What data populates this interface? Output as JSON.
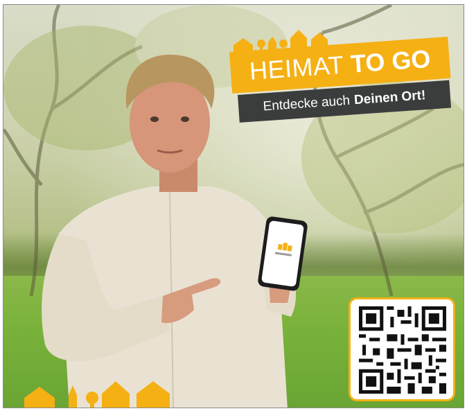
{
  "brand": {
    "title_regular": "HEIMAT",
    "title_bold": "TO GO",
    "subtitle_regular": "Entdecke auch",
    "subtitle_bold": "Deinen Ort!"
  },
  "colors": {
    "accent": "#f5b014",
    "subtitle_bg": "#3b3d3d",
    "text": "#ffffff"
  },
  "icons": [
    "house-skyline-icon",
    "qr-code-icon",
    "smartphone-icon"
  ]
}
